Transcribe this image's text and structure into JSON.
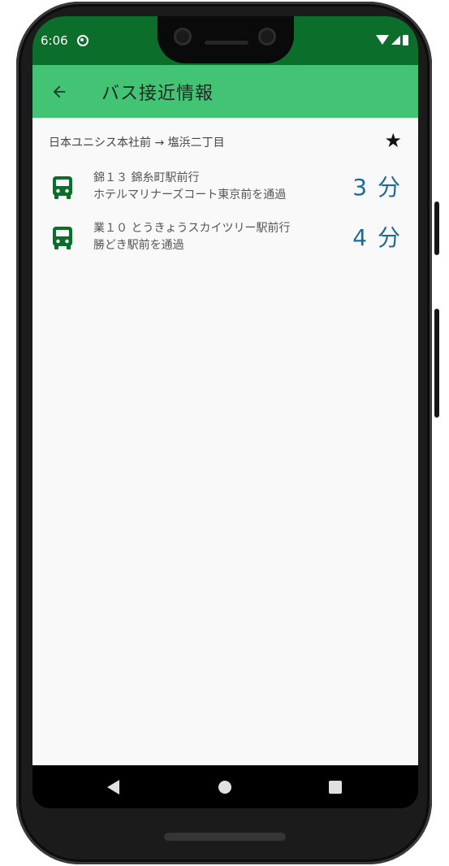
{
  "status_bar": {
    "time": "6:06",
    "icons": [
      "dnd-icon",
      "wifi-icon",
      "signal-icon",
      "battery-icon"
    ]
  },
  "app_bar": {
    "back_icon": "arrow-left-icon",
    "title": "バス接近情報"
  },
  "route": {
    "label": "日本ユニシス本社前 → 塩浜二丁目",
    "favorite_icon": "star-icon"
  },
  "buses": [
    {
      "route_name": "錦１３ 錦糸町駅前行",
      "location": "ホテルマリナーズコート東京前を通過",
      "minutes": "3 分"
    },
    {
      "route_name": "業１０ とうきょうスカイツリー駅前行",
      "location": "勝どき駅前を通過",
      "minutes": "4 分"
    }
  ],
  "nav_bar": {
    "icons": [
      "nav-back-icon",
      "nav-home-icon",
      "nav-recents-icon"
    ]
  },
  "colors": {
    "status_bar": "#0b6e2b",
    "app_bar": "#43c474",
    "bus_icon": "#0b6e2b",
    "minutes_text": "#1c6a98",
    "background": "#f9f9f9"
  }
}
